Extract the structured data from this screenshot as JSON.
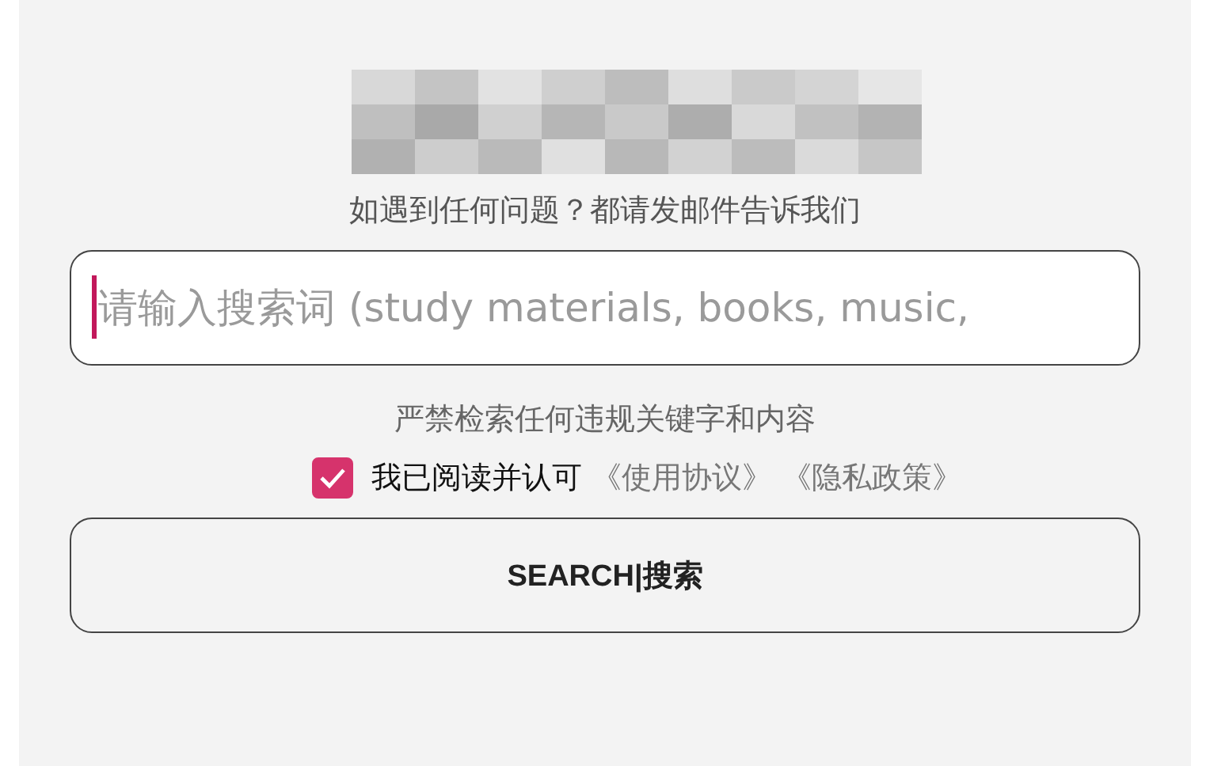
{
  "notice": "如遇到任何问题？都请发邮件告诉我们",
  "search": {
    "placeholder": "请输入搜索词 (study materials, books, music,",
    "focused": true
  },
  "warning": "严禁检索任何违规关键字和内容",
  "agreement": {
    "checked": true,
    "label": "我已阅读并认可",
    "links": [
      "《使用协议》",
      "《隐私政策》"
    ]
  },
  "button": "SEARCH|搜索"
}
